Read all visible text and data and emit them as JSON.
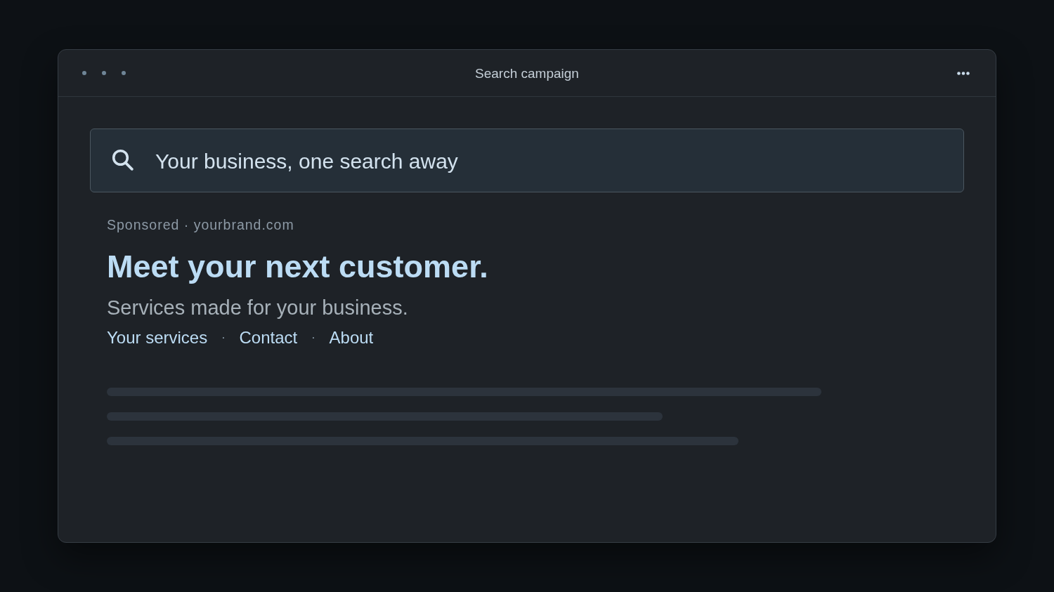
{
  "window": {
    "title": "Search campaign"
  },
  "search": {
    "value": "Your business, one search away"
  },
  "ad": {
    "label": "Sponsored · yourbrand.com",
    "headline": "Meet your next customer.",
    "description": "Services made for your business.",
    "sitelinks": [
      {
        "label": "Your services"
      },
      {
        "label": "Contact"
      },
      {
        "label": "About"
      }
    ],
    "separators": [
      "·",
      "·"
    ]
  }
}
